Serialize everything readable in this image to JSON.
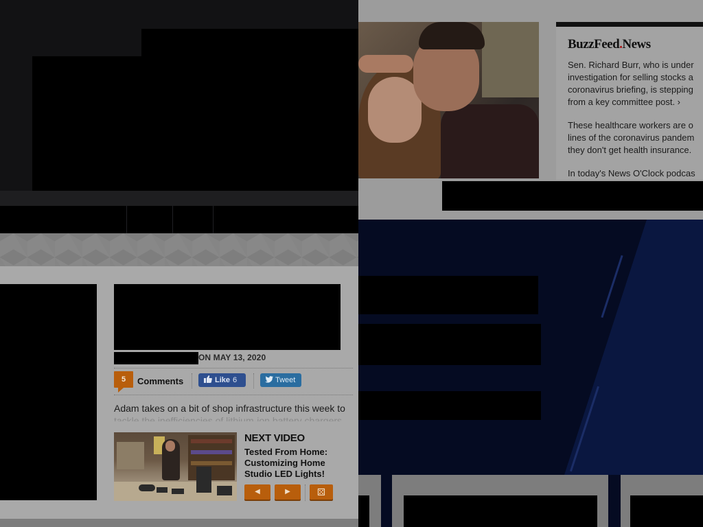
{
  "left_video_page": {
    "post_date": "ON MAY 13, 2020",
    "comments": {
      "count": "5",
      "label": "Comments"
    },
    "like": {
      "label": "Like",
      "count": "6"
    },
    "tweet": {
      "label": "Tweet"
    },
    "description": {
      "visible": "Adam takes on a bit of shop infrastructure this week to",
      "faded": "tackle the inefficiencies of lithium-ion battery chargers"
    },
    "next_video": {
      "heading": "NEXT VIDEO",
      "title": "Tested From Home: Customizing Home Studio LED Lights!"
    },
    "controls": {
      "prev_icon": "◀",
      "next_icon": "▶",
      "random_icon": "⚄"
    }
  },
  "buzzfeed_news": {
    "logo_main": "BuzzFeed",
    "logo_dot": ".",
    "logo_suffix": "News",
    "items": [
      {
        "lines": [
          "Sen. Richard Burr, who is under",
          "investigation for selling stocks a",
          "coronavirus briefing, is stepping",
          "from a key committee post.  ›"
        ]
      },
      {
        "lines": [
          "These healthcare workers are o",
          "lines of the coronavirus pandem",
          "they don't get health insurance."
        ]
      },
      {
        "lines": [
          "In today's News O'Clock podcas"
        ]
      }
    ]
  },
  "colors": {
    "accent_orange": "#b85e0c",
    "facebook_blue": "#2e4f8f",
    "twitter_blue": "#2a6da0",
    "dark_navy": "#050b22"
  }
}
